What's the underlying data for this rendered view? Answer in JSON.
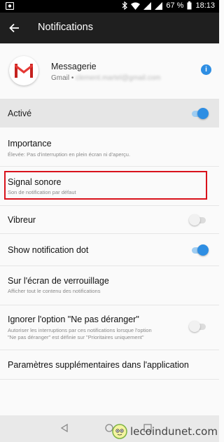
{
  "status_bar": {
    "battery": "67 %",
    "time": "18:13"
  },
  "app_bar": {
    "title": "Notifications"
  },
  "app": {
    "name": "Messagerie",
    "account_prefix": "Gmail •",
    "account_blurred": "clement.martel@gmail.com"
  },
  "settings": {
    "active": {
      "label": "Activé",
      "on": true
    },
    "importance": {
      "label": "Importance",
      "sub": "Élevée: Pas d'interruption en plein écran ni d'aperçu."
    },
    "sound": {
      "label": "Signal sonore",
      "sub": "Son de notification par défaut"
    },
    "vibrate": {
      "label": "Vibreur",
      "on": false
    },
    "dot": {
      "label": "Show notification dot",
      "on": true
    },
    "lockscreen": {
      "label": "Sur l'écran de verrouillage",
      "sub": "Afficher tout le contenu des notifications"
    },
    "dnd": {
      "label": "Ignorer l'option \"Ne pas déranger\"",
      "sub1": "Autoriser les interruptions par ces notifications lorsque l'option",
      "sub2": "\"Ne pas déranger\" est définie sur \"Prioritaires uniquement\"",
      "on": false
    },
    "extra": {
      "label": "Paramètres supplémentaires dans l'application"
    }
  },
  "watermark": {
    "text": "lecoindunet.com"
  },
  "colors": {
    "accent": "#2e8ee3",
    "highlight": "#d9121b"
  },
  "icons": [
    "back-arrow-icon",
    "gmail-icon",
    "info-icon",
    "nav-back-icon",
    "nav-home-icon",
    "nav-recent-icon"
  ]
}
